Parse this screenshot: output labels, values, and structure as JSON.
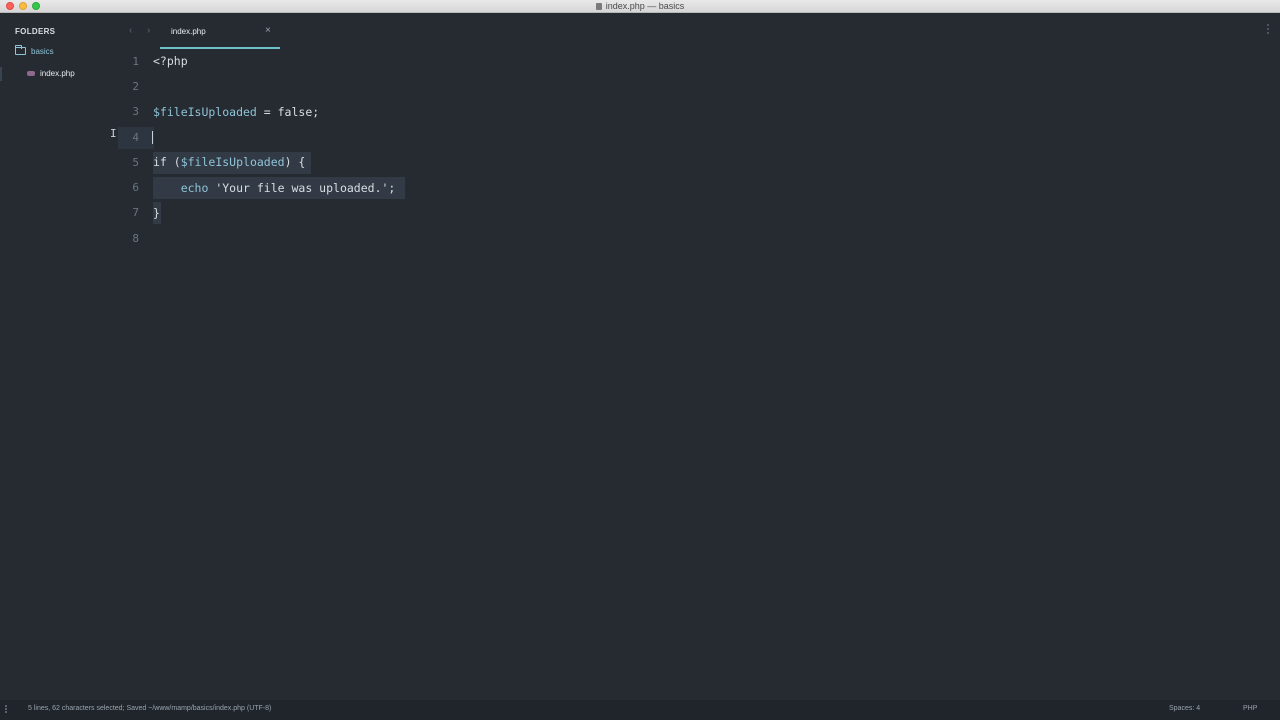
{
  "window": {
    "title": "index.php — basics"
  },
  "sidebar": {
    "header": "FOLDERS",
    "folder": {
      "label": "basics",
      "icon": "folder-icon"
    },
    "files": [
      {
        "label": "index.php",
        "icon": "php-file-icon"
      }
    ]
  },
  "tabs": [
    {
      "label": "index.php",
      "active": true
    }
  ],
  "editor": {
    "lines": [
      {
        "number": "1"
      },
      {
        "number": "2"
      },
      {
        "number": "3"
      },
      {
        "number": "4"
      },
      {
        "number": "5"
      },
      {
        "number": "6"
      },
      {
        "number": "7"
      },
      {
        "number": "8"
      }
    ],
    "code": {
      "open_tag": "<?php",
      "line3_var": "$fileIsUploaded",
      "line3_rest": " = false;",
      "line5_if": "if (",
      "line5_var": "$fileIsUploaded",
      "line5_rest": ") {",
      "line6_indent": "    ",
      "line6_echo": "echo",
      "line6_str": " 'Your file was uploaded.';",
      "line7": "}"
    }
  },
  "statusbar": {
    "info": "5 lines, 62 characters selected; Saved ~/www/mamp/basics/index.php (UTF-8)",
    "spaces": "Spaces: 4",
    "syntax": "PHP"
  },
  "colors": {
    "background": "#252b31",
    "accent": "#6ec1c9",
    "variable": "#8fc3d8"
  }
}
